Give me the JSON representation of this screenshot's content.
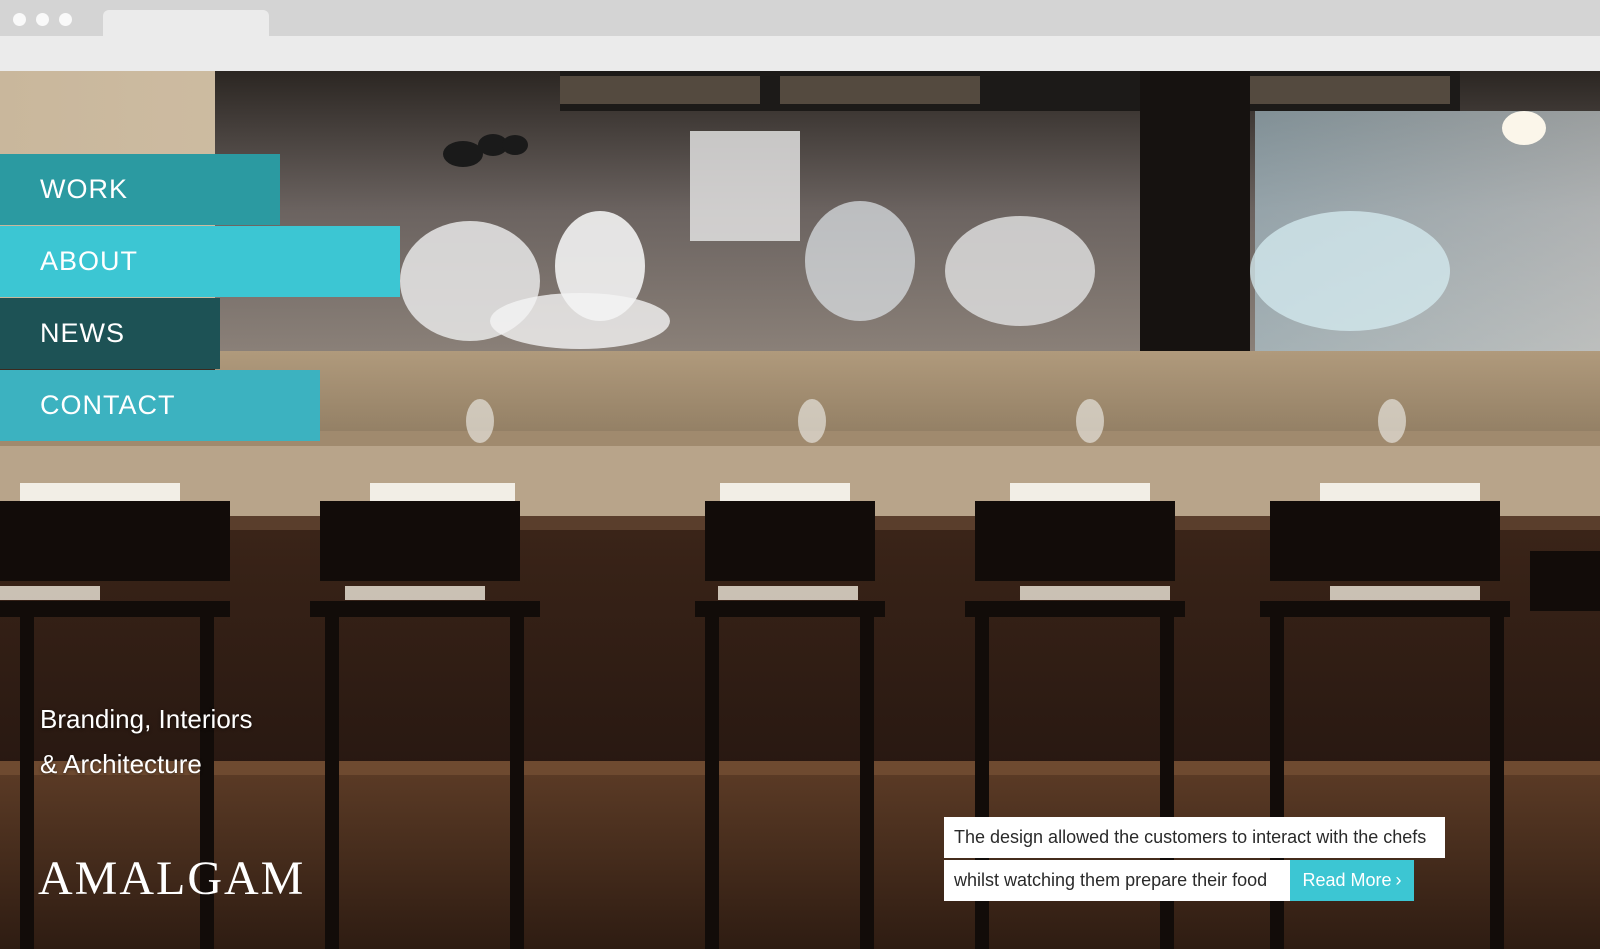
{
  "nav": {
    "items": [
      {
        "label": "WORK"
      },
      {
        "label": "ABOUT"
      },
      {
        "label": "NEWS"
      },
      {
        "label": "CONTACT"
      }
    ]
  },
  "hero": {
    "tagline_line1": "Branding, Interiors",
    "tagline_line2": "& Architecture",
    "logo_text": "AMALGAM",
    "image_description": "restaurant-counter-with-bar-stools-and-open-kitchen-photo"
  },
  "caption": {
    "line1": "The design allowed the customers to interact with the chefs",
    "line2": "whilst watching them prepare their food",
    "read_more_label": "Read More",
    "read_more_icon": "chevron-right-icon"
  },
  "colors": {
    "nav_work": "#2b9aa1",
    "nav_about": "#3cc6d3",
    "nav_news": "#1d5255",
    "nav_contact": "#3cb2c0",
    "accent": "#3cc6d3"
  }
}
